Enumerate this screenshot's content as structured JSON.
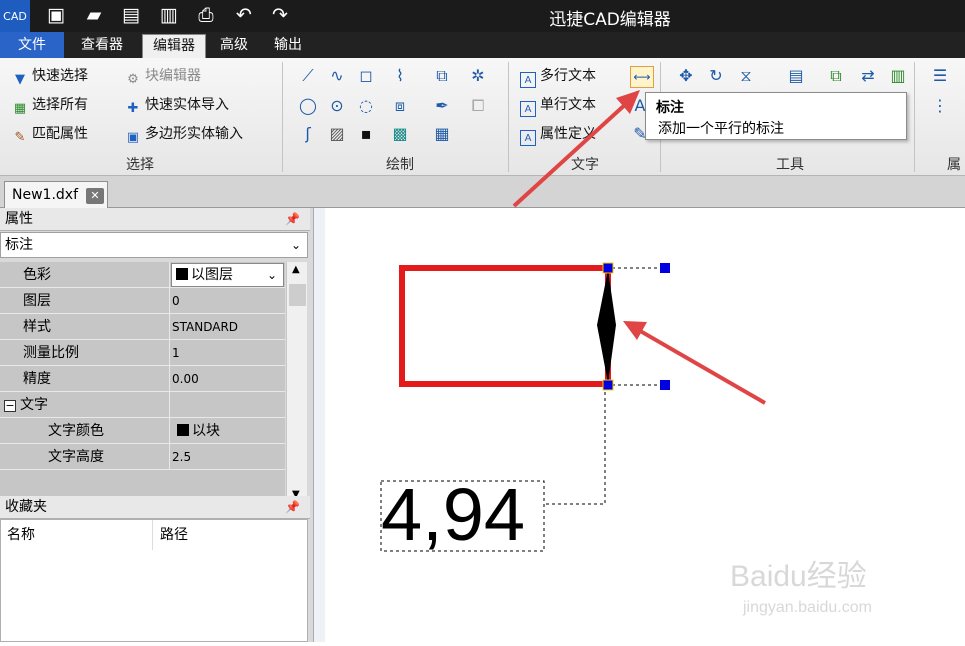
{
  "app": {
    "title": "迅捷CAD编辑器",
    "logo_text": "CAD"
  },
  "menu_tabs": [
    "文件",
    "查看器",
    "编辑器",
    "高级",
    "输出"
  ],
  "ribbon": {
    "select_group": {
      "label": "选择",
      "items": [
        "快速选择",
        "块编辑器",
        "选择所有",
        "快速实体导入",
        "匹配属性",
        "多边形实体输入"
      ]
    },
    "draw_group": {
      "label": "绘制"
    },
    "text_group": {
      "label": "文字",
      "items": [
        "多行文本",
        "单行文本",
        "属性定义"
      ]
    },
    "tools_group": {
      "label": "工具"
    },
    "partial_group": {
      "label": "属"
    }
  },
  "tooltip": {
    "title": "标注",
    "description": "添加一个平行的标注"
  },
  "doc_tab": {
    "name": "New1.dxf"
  },
  "properties_panel": {
    "title": "属性",
    "selected_type": "标注",
    "rows": [
      {
        "key": "色彩",
        "value": "以图层"
      },
      {
        "key": "图层",
        "value": "0"
      },
      {
        "key": "样式",
        "value": "STANDARD"
      },
      {
        "key": "测量比例",
        "value": "1"
      },
      {
        "key": "精度",
        "value": "0.00"
      },
      {
        "key": "文字",
        "value": ""
      },
      {
        "key": "文字颜色",
        "value": "以块"
      },
      {
        "key": "文字高度",
        "value": "2.5"
      }
    ]
  },
  "favorites_panel": {
    "title": "收藏夹",
    "columns": [
      "名称",
      "路径"
    ]
  },
  "drawing": {
    "dimension_text": "4,94"
  },
  "watermark": {
    "brand": "Baidu经验",
    "url": "jingyan.baidu.com"
  },
  "colors": {
    "accent": "#2a64c8",
    "shape_stroke": "#e31b1b",
    "arrow": "#e04545",
    "grip": "#0000e0"
  }
}
